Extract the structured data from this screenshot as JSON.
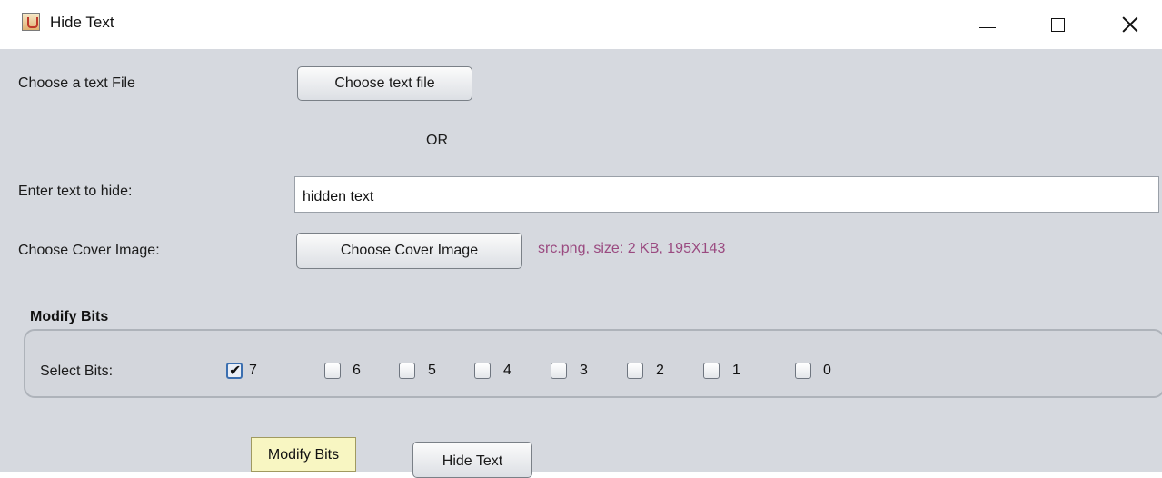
{
  "window": {
    "title": "Hide Text",
    "icon": "java-cup-icon",
    "controls": {
      "minimize": "minimize-icon",
      "maximize": "maximize-icon",
      "close": "close-icon"
    }
  },
  "text_file": {
    "label": "Choose a text File",
    "button": "Choose text file"
  },
  "separator": "OR",
  "hide_text": {
    "label": "Enter text to hide:",
    "value": "hidden text"
  },
  "cover": {
    "label": "Choose Cover Image:",
    "button": "Choose Cover Image",
    "info": "src.png, size: 2 KB, 195X143",
    "info_color": "#9a4a80"
  },
  "modify": {
    "title": "Modify Bits",
    "select_label": "Select Bits:",
    "bits": [
      {
        "label": "7",
        "checked": true
      },
      {
        "label": "6",
        "checked": false
      },
      {
        "label": "5",
        "checked": false
      },
      {
        "label": "4",
        "checked": false
      },
      {
        "label": "3",
        "checked": false
      },
      {
        "label": "2",
        "checked": false
      },
      {
        "label": "1",
        "checked": false
      },
      {
        "label": "0",
        "checked": false
      }
    ]
  },
  "tooltip": "Modify Bits",
  "actions": {
    "hide_button": "Hide Text"
  }
}
